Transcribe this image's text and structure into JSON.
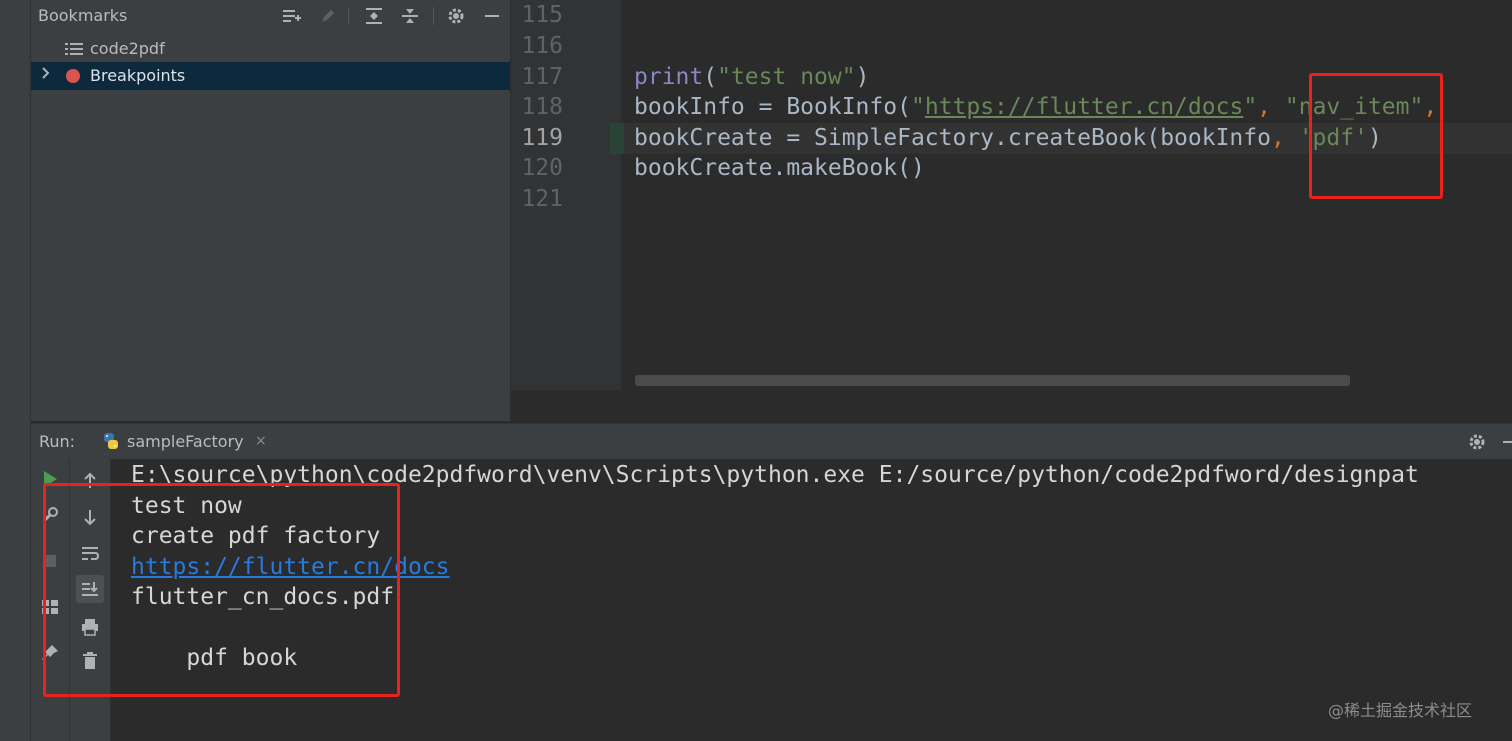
{
  "bookmarks": {
    "title": "Bookmarks",
    "items": [
      {
        "label": "code2pdf",
        "icon": "list-icon"
      },
      {
        "label": "Breakpoints",
        "icon": "breakpoint-icon"
      }
    ]
  },
  "editor": {
    "line_numbers": [
      "115",
      "116",
      "117",
      "118",
      "119",
      "120",
      "121"
    ],
    "current_line": "119",
    "lines": {
      "l117": {
        "fn": "print",
        "open": "(",
        "str": "\"test now\"",
        "close": ")"
      },
      "l118": {
        "a": "bookInfo = BookInfo(",
        "q1": "\"",
        "url": "https://flutter.cn/docs",
        "q2": "\"",
        "comma": ", ",
        "str": "\"nav_item\"",
        "comma2": ","
      },
      "l119": {
        "a": "bookCreate = SimpleFactory.createBook(bookInfo",
        "comma": ", ",
        "str": "'pdf'",
        "close": ")"
      },
      "l120": {
        "a": "bookCreate.makeBook()"
      }
    }
  },
  "run": {
    "label": "Run:",
    "tab_label": "sampleFactory",
    "tab_close": "×",
    "console_lines": [
      "E:\\source\\python\\code2pdfword\\venv\\Scripts\\python.exe E:/source/python/code2pdfword/designpat",
      "test now",
      "create pdf factory",
      "https://flutter.cn/docs",
      "flutter_cn_docs.pdf",
      "",
      "    pdf book"
    ]
  },
  "colors": {
    "highlight_box": "#e8231d",
    "link": "#287bde",
    "string": "#6a8759",
    "keyword": "#cc7832"
  },
  "watermark": "@稀土掘金技术社区"
}
